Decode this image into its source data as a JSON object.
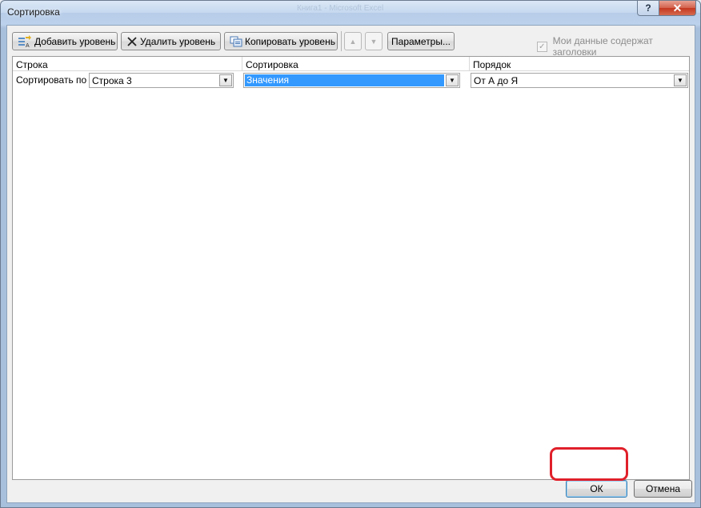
{
  "window": {
    "title": "Сортировка",
    "ghost_title": "Книга1 - Microsoft Excel",
    "help_label": "?",
    "close_label": "✕"
  },
  "toolbar": {
    "add_level": "Добавить уровень",
    "delete_level": "Удалить уровень",
    "copy_level": "Копировать уровень",
    "move_up_label": "▲",
    "move_down_label": "▼",
    "options": "Параметры...",
    "headers_checkbox_label": "Мои данные содержат заголовки",
    "headers_checkbox_checked": true
  },
  "grid": {
    "columns": [
      "Строка",
      "Сортировка",
      "Порядок"
    ],
    "rows": [
      {
        "label": "Сортировать по",
        "row_value": "Строка 3",
        "sort_on": "Значения",
        "order": "От А до Я"
      }
    ]
  },
  "footer": {
    "ok": "ОК",
    "cancel": "Отмена"
  },
  "colors": {
    "highlight": "#e0202a",
    "selection": "#3399ff"
  }
}
